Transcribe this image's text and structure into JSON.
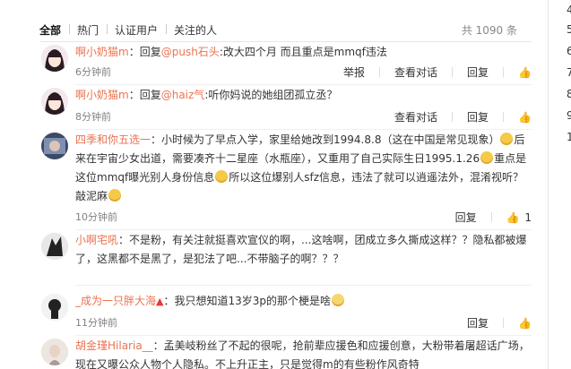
{
  "tabs": [
    "全部",
    "热门",
    "认证用户",
    "关注的人"
  ],
  "count": "共 1090 条",
  "actions": {
    "report": "举报",
    "view_conv": "查看对话",
    "reply": "回复"
  },
  "comments": [
    {
      "user": "啊小奶猫m",
      "text_a": "：回复",
      "mention": "@push石头",
      "text_b": ":改大四个月 而且重点是mmqf违法",
      "time": "6分钟前"
    },
    {
      "user": "啊小奶猫m",
      "text_a": "：回复",
      "mention": "@haiz气",
      "text_b": ":听你妈说的她组团孤立丞？",
      "time": "8分钟前"
    },
    {
      "user": "四季和你五选一",
      "line1": "：小时候为了早点入学，家里给她改到1994.8.8（这在中国是常见现象）",
      "line1b": "后",
      "line2": "来在宇宙少女出道，需要凑齐十二星座（水瓶座），又重用了自己实际生日1995.1.26",
      "line2b": "重点是",
      "line3": "这位mmqf曝光别人身份信息",
      "line3b": "所以这位爆别人sfz信息，违法了就可以逍遥法外，混淆视听？",
      "line4": "敲泥麻",
      "time": "10分钟前",
      "likes": "1"
    },
    {
      "user": "小啊宅吼",
      "line1": "：不是粉，有关注就挺喜欢宣仪的啊，...这啥啊，团成立多久撕成这样？？隐私都被爆",
      "line2": "了，这黑都不是黑了，是犯法了吧...不带脑子的啊？？？",
      "time": ""
    },
    {
      "user": "_成为一只胖大海",
      "line1": "：我只想知道13岁3p的那个梗是啥",
      "time": "11分钟前"
    },
    {
      "user": "胡金瑾Hilaria__",
      "line1": "：孟美岐粉丝了不起的很呢，抢前辈应援色和应援创意，大粉带着屠超话广",
      "line2": "场，现在又曝公众人物个人隐私。不上升正主，只是觉得m的有些粉作风奇特",
      "time": ""
    }
  ],
  "right_numbers": [
    "4",
    "5",
    "6",
    "7",
    "8",
    "9",
    "1"
  ]
}
